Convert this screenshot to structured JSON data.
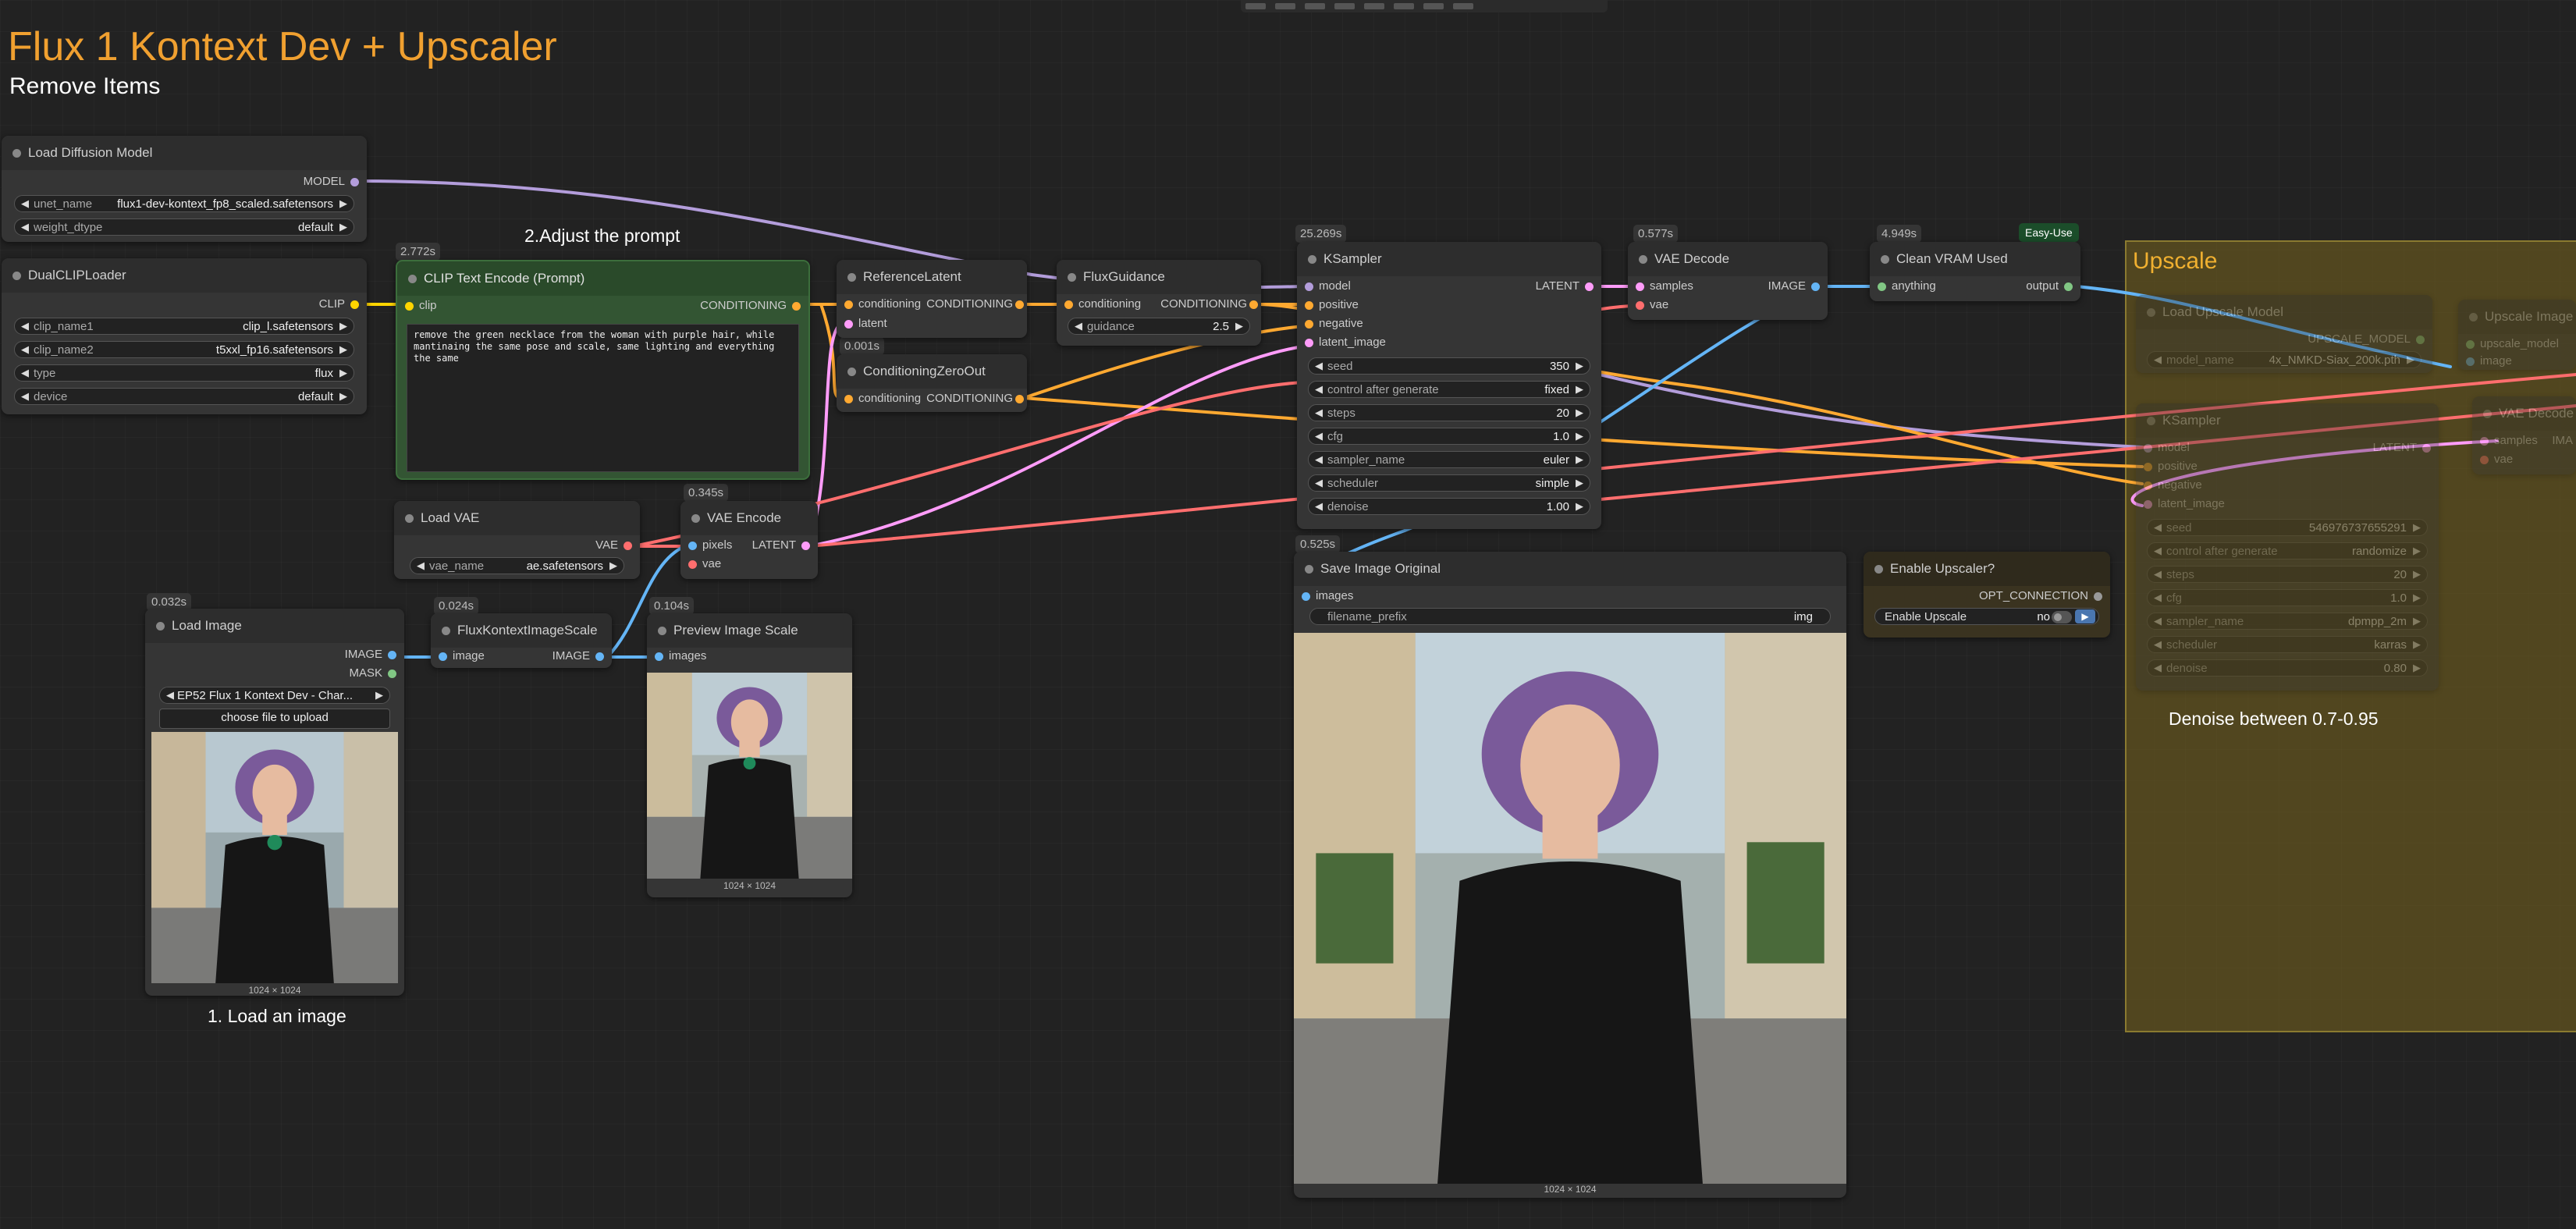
{
  "header": {
    "title": "Flux 1 Kontext Dev + Upscaler",
    "subtitle": "Remove Items"
  },
  "notes": {
    "adjust_prompt": "2.Adjust the prompt",
    "load_image": "1. Load an image",
    "denoise": "Denoise between 0.7-0.95"
  },
  "timings": {
    "clip_text": "2.772s",
    "cond_zero": "0.001s",
    "ksampler": "25.269s",
    "vae_decode": "0.577s",
    "clean_vram": "4.949s",
    "vae_encode": "0.345s",
    "save_image": "0.525s",
    "load_image": "0.032s",
    "flux_scale": "0.024s",
    "preview_scale": "0.104s"
  },
  "badges": {
    "easy_use": "Easy-Use"
  },
  "nodes": {
    "load_diffusion": {
      "title": "Load Diffusion Model",
      "out_model": "MODEL",
      "unet_label": "unet_name",
      "unet_value": "flux1-dev-kontext_fp8_scaled.safetensors",
      "dtype_label": "weight_dtype",
      "dtype_value": "default"
    },
    "dual_clip": {
      "title": "DualCLIPLoader",
      "out_clip": "CLIP",
      "clip1_label": "clip_name1",
      "clip1_value": "clip_l.safetensors",
      "clip2_label": "clip_name2",
      "clip2_value": "t5xxl_fp16.safetensors",
      "type_label": "type",
      "type_value": "flux",
      "device_label": "device",
      "device_value": "default"
    },
    "clip_text": {
      "title": "CLIP Text Encode (Prompt)",
      "in_clip": "clip",
      "out_cond": "CONDITIONING",
      "prompt": "remove the green necklace from the woman with purple hair, while mantinaing the same pose and scale, same lighting and everything the same"
    },
    "ref_latent": {
      "title": "ReferenceLatent",
      "in_cond": "conditioning",
      "in_latent": "latent",
      "out_cond": "CONDITIONING"
    },
    "cond_zero": {
      "title": "ConditioningZeroOut",
      "in_cond": "conditioning",
      "out_cond": "CONDITIONING"
    },
    "flux_guidance": {
      "title": "FluxGuidance",
      "in_cond": "conditioning",
      "out_cond": "CONDITIONING",
      "guidance_label": "guidance",
      "guidance_value": "2.5"
    },
    "ksampler": {
      "title": "KSampler",
      "in_model": "model",
      "in_pos": "positive",
      "in_neg": "negative",
      "in_latent": "latent_image",
      "out_latent": "LATENT",
      "widgets": [
        {
          "label": "seed",
          "value": "350"
        },
        {
          "label": "control after generate",
          "value": "fixed"
        },
        {
          "label": "steps",
          "value": "20"
        },
        {
          "label": "cfg",
          "value": "1.0"
        },
        {
          "label": "sampler_name",
          "value": "euler"
        },
        {
          "label": "scheduler",
          "value": "simple"
        },
        {
          "label": "denoise",
          "value": "1.00"
        }
      ]
    },
    "vae_decode": {
      "title": "VAE Decode",
      "in_samples": "samples",
      "in_vae": "vae",
      "out_image": "IMAGE"
    },
    "clean_vram": {
      "title": "Clean VRAM Used",
      "in_anything": "anything",
      "out_output": "output"
    },
    "load_vae": {
      "title": "Load VAE",
      "out_vae": "VAE",
      "vae_label": "vae_name",
      "vae_value": "ae.safetensors"
    },
    "vae_encode": {
      "title": "VAE Encode",
      "in_pixels": "pixels",
      "in_vae": "vae",
      "out_latent": "LATENT"
    },
    "load_image": {
      "title": "Load Image",
      "out_image": "IMAGE",
      "out_mask": "MASK",
      "file_value": "EP52 Flux 1 Kontext Dev - Char...",
      "upload": "choose file to upload",
      "dims": "1024 × 1024"
    },
    "flux_scale": {
      "title": "FluxKontextImageScale",
      "in_image": "image",
      "out_image": "IMAGE"
    },
    "preview_scale": {
      "title": "Preview Image Scale",
      "in_images": "images",
      "dims": "1024 × 1024"
    },
    "save_image": {
      "title": "Save Image Original",
      "in_images": "images",
      "prefix_label": "filename_prefix",
      "prefix_value": "img",
      "dims": "1024 × 1024"
    },
    "enable_upscaler": {
      "title": "Enable Upscaler?",
      "out_opt": "OPT_CONNECTION",
      "toggle_label": "Enable Upscale",
      "toggle_value": "no"
    }
  },
  "upscale_group": {
    "title": "Upscale",
    "load_upscale": {
      "title": "Load Upscale Model",
      "out": "UPSCALE_MODEL",
      "model_label": "model_name",
      "model_value": "4x_NMKD-Siax_200k.pth"
    },
    "upscale_image": {
      "title": "Upscale Image",
      "in_model": "upscale_model",
      "in_image": "image"
    },
    "ksampler2": {
      "title": "KSampler",
      "in_model": "model",
      "in_pos": "positive",
      "in_neg": "negative",
      "in_latent": "latent_image",
      "out_latent": "LATENT",
      "widgets": [
        {
          "label": "seed",
          "value": "546976737655291"
        },
        {
          "label": "control after generate",
          "value": "randomize"
        },
        {
          "label": "steps",
          "value": "20"
        },
        {
          "label": "cfg",
          "value": "1.0"
        },
        {
          "label": "sampler_name",
          "value": "dpmpp_2m"
        },
        {
          "label": "scheduler",
          "value": "karras"
        },
        {
          "label": "denoise",
          "value": "0.80"
        }
      ]
    },
    "vae_decode2": {
      "title": "VAE Decode",
      "in_samples": "samples",
      "in_vae": "vae",
      "out": "IMA"
    }
  },
  "colors": {
    "model": "#b39ddb",
    "clip": "#ffd500",
    "conditioning": "#ffa931",
    "latent": "#ff9cf9",
    "vae": "#ff6e6e",
    "image": "#64b5f6",
    "mask": "#81c784"
  }
}
